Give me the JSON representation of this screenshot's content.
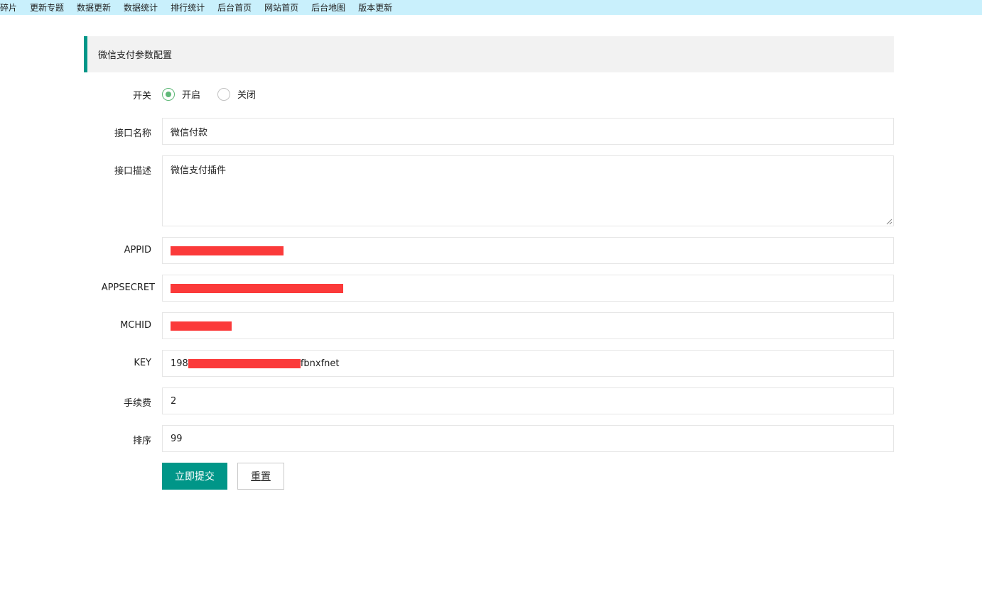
{
  "topnav": {
    "items": [
      "碎片",
      "更新专题",
      "数据更新",
      "数据统计",
      "排行统计",
      "后台首页",
      "网站首页",
      "后台地图",
      "版本更新"
    ]
  },
  "section": {
    "title": "微信支付参数配置"
  },
  "form": {
    "switch": {
      "label": "开关",
      "options": [
        "开启",
        "关闭"
      ],
      "selected": "开启"
    },
    "name": {
      "label": "接口名称",
      "value": "微信付款"
    },
    "desc": {
      "label": "接口描述",
      "value": "微信支付插件"
    },
    "appid": {
      "label": "APPID"
    },
    "appsecret": {
      "label": "APPSECRET"
    },
    "mchid": {
      "label": "MCHID"
    },
    "key": {
      "label": "KEY",
      "prefix": "198",
      "suffix": "fbnxfnet"
    },
    "fee": {
      "label": "手续费",
      "value": "2"
    },
    "sort": {
      "label": "排序",
      "value": "99"
    }
  },
  "buttons": {
    "submit": "立即提交",
    "reset": "重置"
  },
  "colors": {
    "accent": "#009688",
    "radio_on": "#5fb878",
    "redaction": "#fb3a3a",
    "nav_bg": "#c9f0fc"
  }
}
